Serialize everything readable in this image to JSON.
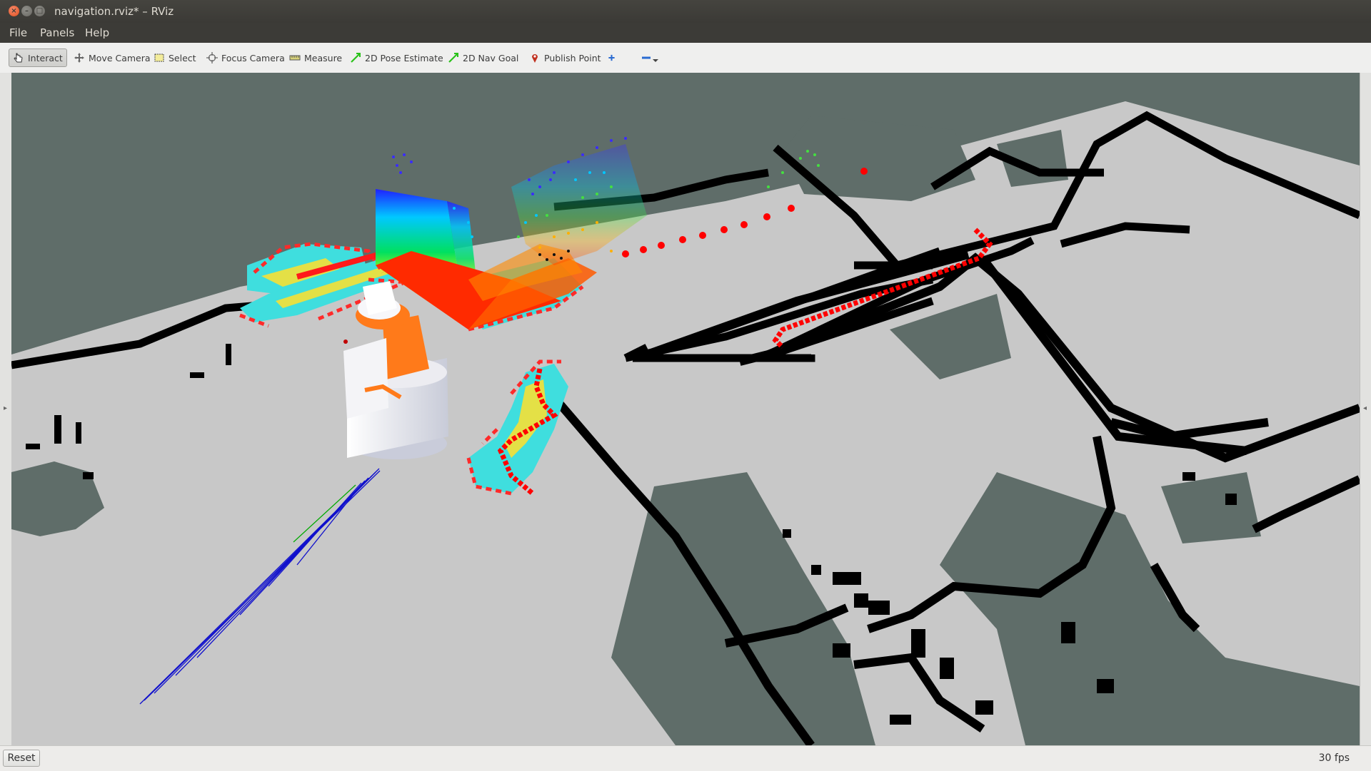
{
  "window": {
    "title": "navigation.rviz* – RViz"
  },
  "menu": {
    "file": "File",
    "panels": "Panels",
    "help": "Help"
  },
  "toolbar": {
    "interact": "Interact",
    "move_camera": "Move Camera",
    "select": "Select",
    "focus_camera": "Focus Camera",
    "measure": "Measure",
    "pose_estimate": "2D Pose Estimate",
    "nav_goal": "2D Nav Goal",
    "publish_point": "Publish Point"
  },
  "status": {
    "reset": "Reset",
    "fps": "30 fps"
  },
  "colors": {
    "map_free": "#c8c8c8",
    "map_unknown": "#5f6d69",
    "map_occupied": "#000000",
    "costmap_inflation": "#3fdede",
    "costmap_inscribed": "#e4e046",
    "costmap_lethal": "#ff1a1a",
    "plan_path": "#ff0000",
    "laser_scan": "#0000cc"
  }
}
